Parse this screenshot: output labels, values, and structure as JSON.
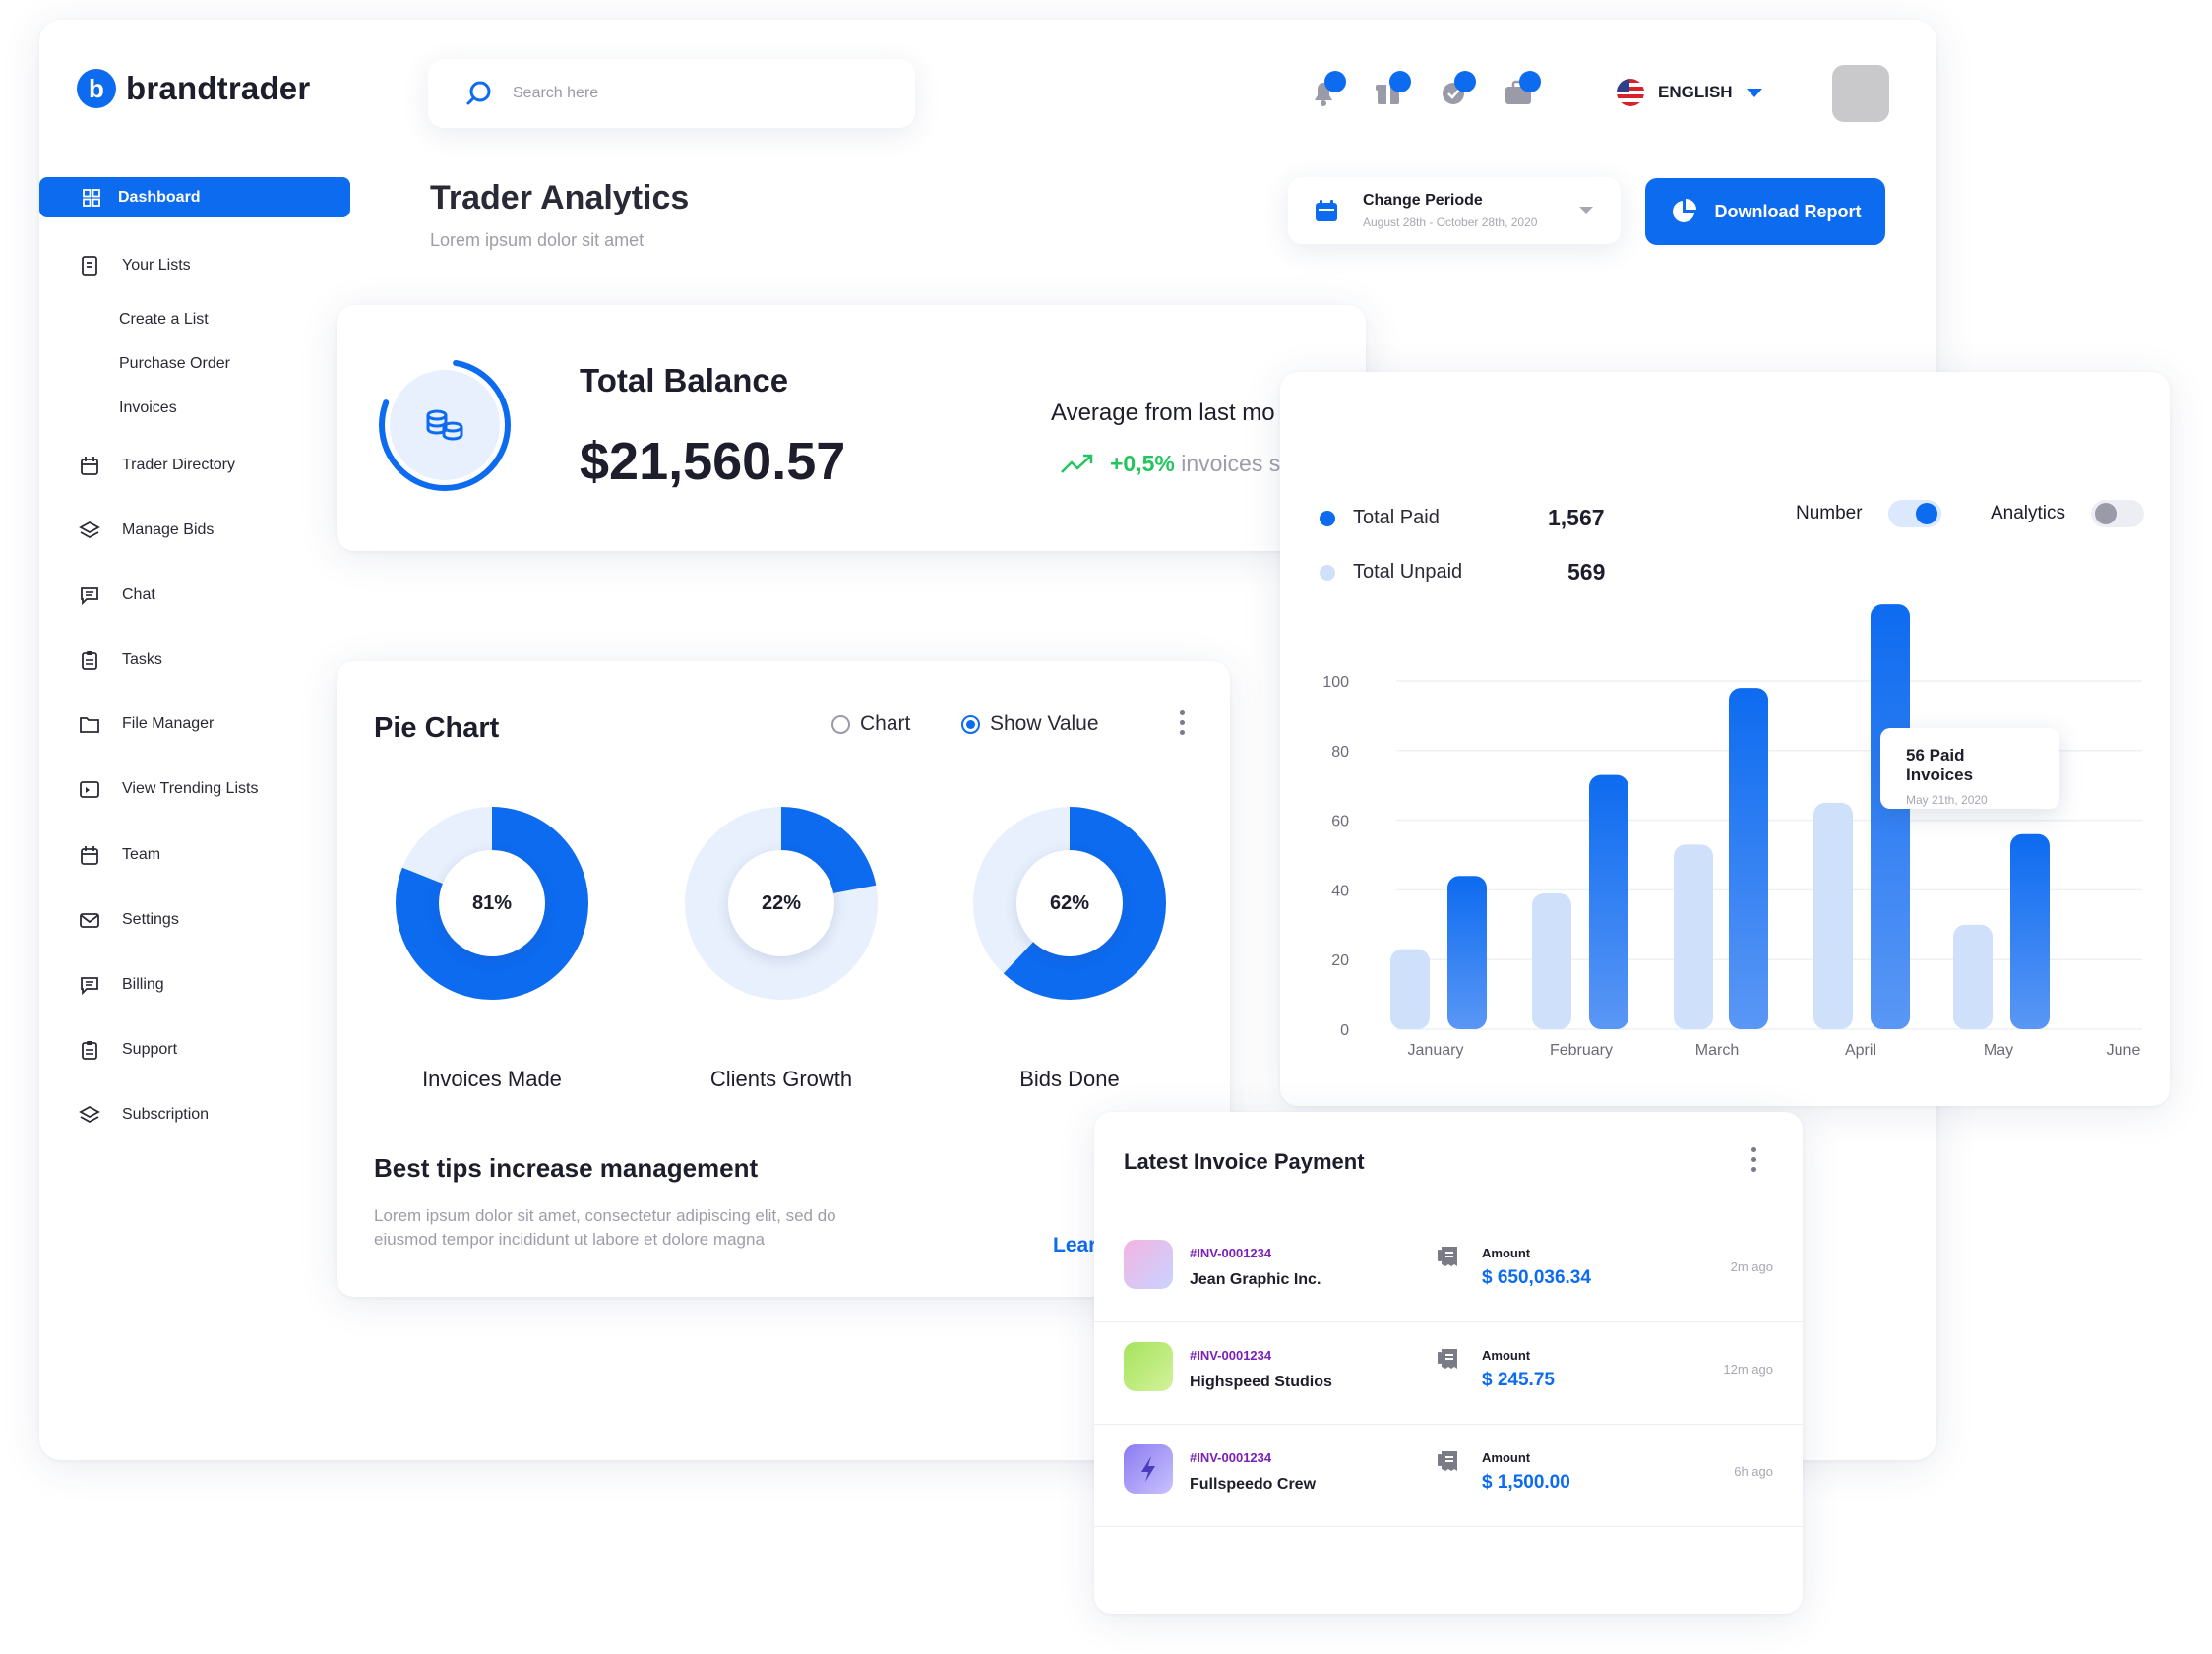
{
  "brand": {
    "name": "brandtrader",
    "mark": "b",
    "accent": "#0d6bf0"
  },
  "search": {
    "placeholder": "Search here"
  },
  "header": {
    "language": "ENGLISH",
    "notification_icons": [
      "bell-icon",
      "gift-icon",
      "chat-check-icon",
      "briefcase-icon"
    ]
  },
  "sidebar": {
    "active": {
      "label": "Dashboard",
      "icon": "grid-icon"
    },
    "items": [
      {
        "label": "Your Lists",
        "icon": "list-icon"
      },
      {
        "label": "Create a List",
        "sub": true
      },
      {
        "label": "Purchase Order",
        "sub": true
      },
      {
        "label": "Invoices",
        "sub": true
      },
      {
        "label": "Trader Directory",
        "icon": "calendar-icon"
      },
      {
        "label": "Manage Bids",
        "icon": "layers-icon"
      },
      {
        "label": "Chat",
        "icon": "message-icon"
      },
      {
        "label": "Tasks",
        "icon": "clipboard-icon"
      },
      {
        "label": "File Manager",
        "icon": "folder-icon"
      },
      {
        "label": "View Trending Lists",
        "icon": "trending-icon"
      },
      {
        "label": "Team",
        "icon": "calendar-icon"
      },
      {
        "label": "Settings",
        "icon": "mail-icon"
      },
      {
        "label": "Billing",
        "icon": "message-icon"
      },
      {
        "label": "Support",
        "icon": "clipboard-icon"
      },
      {
        "label": "Subscription",
        "icon": "layers-icon"
      }
    ]
  },
  "page": {
    "title": "Trader Analytics",
    "subtitle": "Lorem ipsum  dolor sit amet"
  },
  "period": {
    "label": "Change Periode",
    "range": "August 28th - October 28th, 2020"
  },
  "download": {
    "label": "Download Report"
  },
  "balance": {
    "title": "Total Balance",
    "value": "$21,560.57",
    "avg_label": "Average from last mo",
    "avg_change": "+0,5%",
    "avg_suffix": "invoices s",
    "ring_progress": 0.78
  },
  "bar_panel": {
    "legend": [
      {
        "label": "Total Paid",
        "value": "1,567",
        "color": "#0d6bf0"
      },
      {
        "label": "Total Unpaid",
        "value": "569",
        "color": "#cfe0fb"
      }
    ],
    "toggles": [
      {
        "label": "Number",
        "on": true
      },
      {
        "label": "Analytics",
        "on": false
      }
    ],
    "tooltip": {
      "title": "56 Paid Invoices",
      "date": "May 21th, 2020"
    },
    "chart_data": {
      "type": "bar",
      "categories": [
        "January",
        "February",
        "March",
        "April",
        "May",
        "June"
      ],
      "ylim": [
        0,
        100
      ],
      "y_ticks": [
        "100",
        "80",
        "60",
        "40",
        "20",
        "0"
      ],
      "grid": true,
      "series": [
        {
          "name": "Total Unpaid",
          "color": "#cfe0fb",
          "values": [
            23,
            39,
            53,
            65,
            30
          ]
        },
        {
          "name": "Total Paid",
          "color": "#0d6bf0",
          "values": [
            44,
            73,
            98,
            122,
            56
          ]
        }
      ]
    }
  },
  "pie_panel": {
    "title": "Pie Chart",
    "options": [
      {
        "label": "Chart",
        "selected": false
      },
      {
        "label": "Show Value",
        "selected": true
      }
    ],
    "chart_data": {
      "type": "pie",
      "donuts": [
        {
          "label": "Invoices Made",
          "value": 81,
          "text": "81%"
        },
        {
          "label": "Clients Growth",
          "value": 22,
          "text": "22%"
        },
        {
          "label": "Bids Done",
          "value": 62,
          "text": "62%"
        }
      ]
    },
    "tips_title": "Best tips increase management",
    "tips_text_1": "Lorem ipsum dolor sit amet, consectetur adipiscing elit, sed do",
    "tips_text_2": "eiusmod tempor incididunt ut labore et dolore magna",
    "learn_more": "Lear"
  },
  "invoices": {
    "title": "Latest Invoice Payment",
    "amount_label": "Amount",
    "rows": [
      {
        "id": "#INV-0001234",
        "name": "Jean Graphic Inc.",
        "amount": "$ 650,036.34",
        "time": "2m ago",
        "icon_colors": [
          "#f3b4e2",
          "#c9d3ff"
        ]
      },
      {
        "id": "#INV-0001234",
        "name": "Highspeed Studios",
        "amount": "$ 245.75",
        "time": "12m ago",
        "icon_colors": [
          "#a6e35d",
          "#d3f29b"
        ]
      },
      {
        "id": "#INV-0001234",
        "name": "Fullspeedo Crew",
        "amount": "$ 1,500.00",
        "time": "6h ago",
        "icon_colors": [
          "#8b7bf0",
          "#c9c2ff"
        ]
      }
    ]
  }
}
